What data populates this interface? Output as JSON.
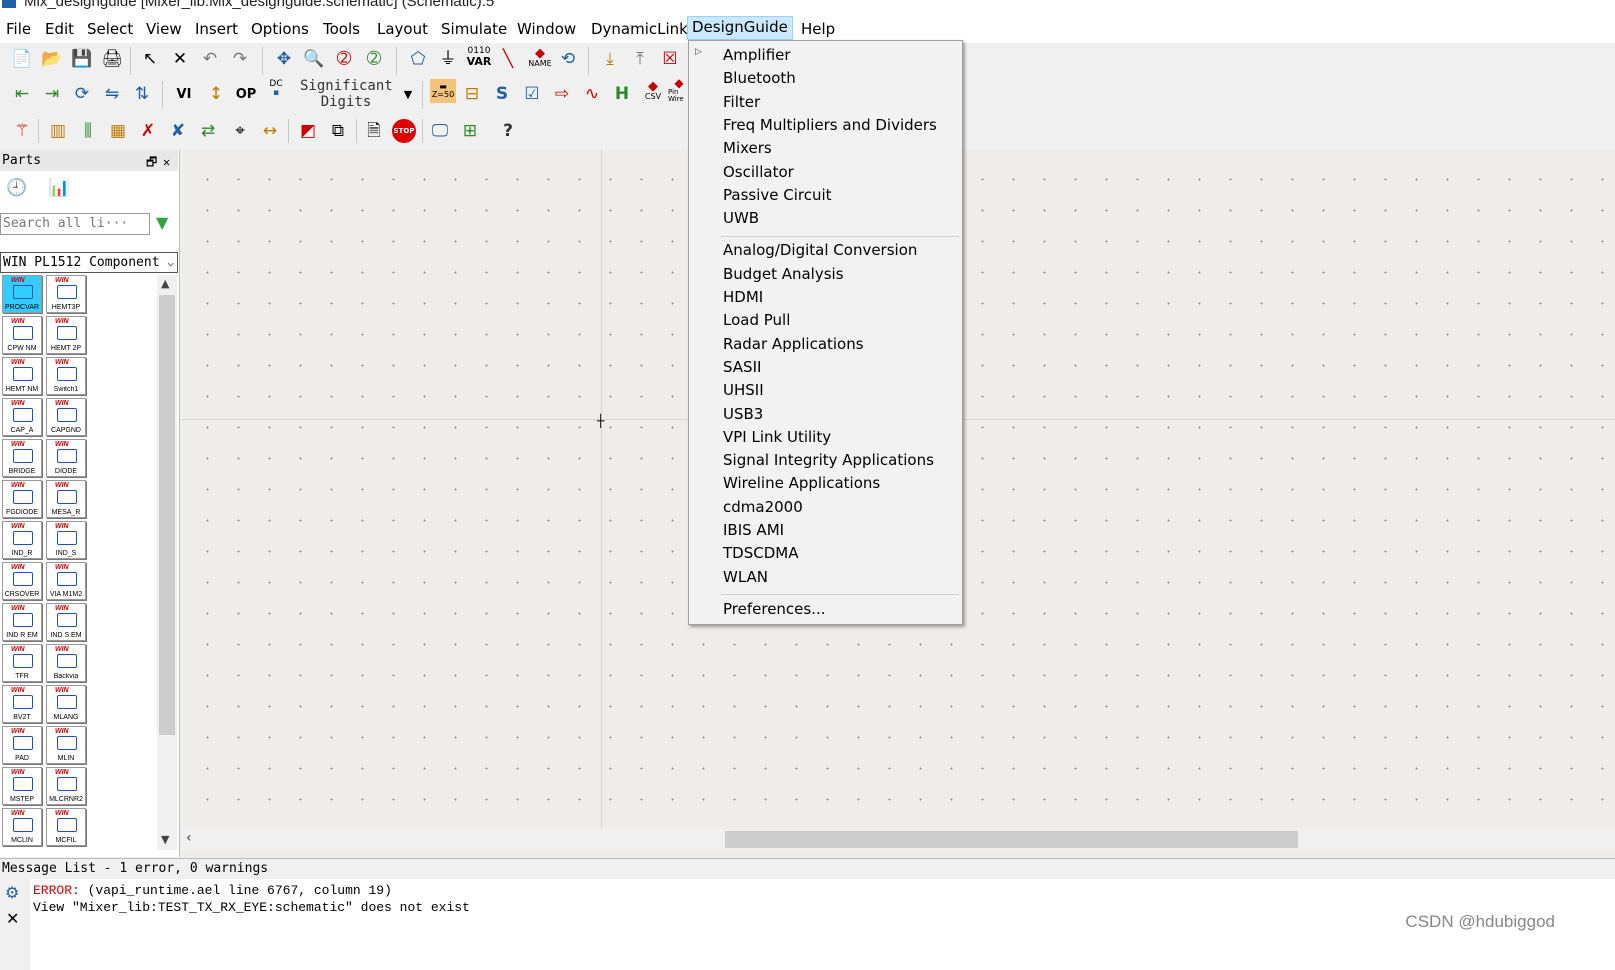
{
  "window": {
    "title": "Mix_designguide [Mixer_lib:Mix_designguide:schematic] (Schematic):5"
  },
  "menubar": {
    "items": [
      "File",
      "Edit",
      "Select",
      "View",
      "Insert",
      "Options",
      "Tools",
      "Layout",
      "Simulate",
      "Window",
      "DynamicLink",
      "DesignGuide",
      "Help"
    ],
    "active": "DesignGuide"
  },
  "toolbar": {
    "significant_digits_label": "Significant Digits",
    "var_label": "VAR",
    "binary_label": "0110",
    "name_label": "NAME",
    "z50_label": "Z=50",
    "csv_label": "CSV",
    "pin_label": "Pin Wire",
    "stop_label": "STOP",
    "dc_label": "DC",
    "vi_label": "VI",
    "op_label": "OP",
    "help_label": "?"
  },
  "parts_panel": {
    "title": "Parts",
    "search_placeholder": "Search all li···",
    "library": "WIN PL1512 Component",
    "components": [
      [
        "PROCVAR",
        "HEMT3P"
      ],
      [
        "CPW NM",
        "HEMT 2P"
      ],
      [
        "HEMT NM",
        "Switch1"
      ],
      [
        "CAP_A",
        "CAPGND"
      ],
      [
        "BRIDGE",
        "DIODE"
      ],
      [
        "FGDIODE",
        "MESA_R"
      ],
      [
        "IND_R",
        "IND_S"
      ],
      [
        "CRSOVER",
        "VIA M1M2"
      ],
      [
        "IND R EM",
        "IND S EM"
      ],
      [
        "TFR",
        "Backvia"
      ],
      [
        "BV2T",
        "MLANG"
      ],
      [
        "PAD",
        "MLIN"
      ],
      [
        "MSTEP",
        "MLCRNR2"
      ],
      [
        "MCLIN",
        "MCFIL"
      ]
    ],
    "logo_text": "WIN"
  },
  "designguide_menu": {
    "group1": [
      "Amplifier",
      "Bluetooth",
      "Filter",
      "Freq Multipliers and Dividers",
      "Mixers",
      "Oscillator",
      "Passive Circuit",
      "UWB"
    ],
    "group2": [
      "Analog/Digital Conversion",
      "Budget Analysis",
      "HDMI",
      "Load Pull",
      "Radar Applications",
      "SASII",
      "UHSII",
      "USB3",
      "VPI Link Utility",
      "Signal Integrity Applications",
      "Wireline Applications",
      "cdma2000",
      "IBIS AMI",
      "TDSCDMA",
      "WLAN"
    ],
    "group3": [
      "Preferences..."
    ]
  },
  "message_list": {
    "title": "Message List - 1 error, 0 warnings",
    "error_label": "ERROR:",
    "error_detail": "(vapi_runtime.ael line 6767, column 19)",
    "error_line2": "View \"Mixer_lib:TEST_TX_RX_EYE:schematic\" does not exist"
  },
  "watermark": "CSDN @hdubiggod",
  "colors": {
    "menu_active_bg": "#cce8ff",
    "error_red": "#e00000",
    "canvas_bg": "#efedeb",
    "selected_part": "#33ccff"
  }
}
